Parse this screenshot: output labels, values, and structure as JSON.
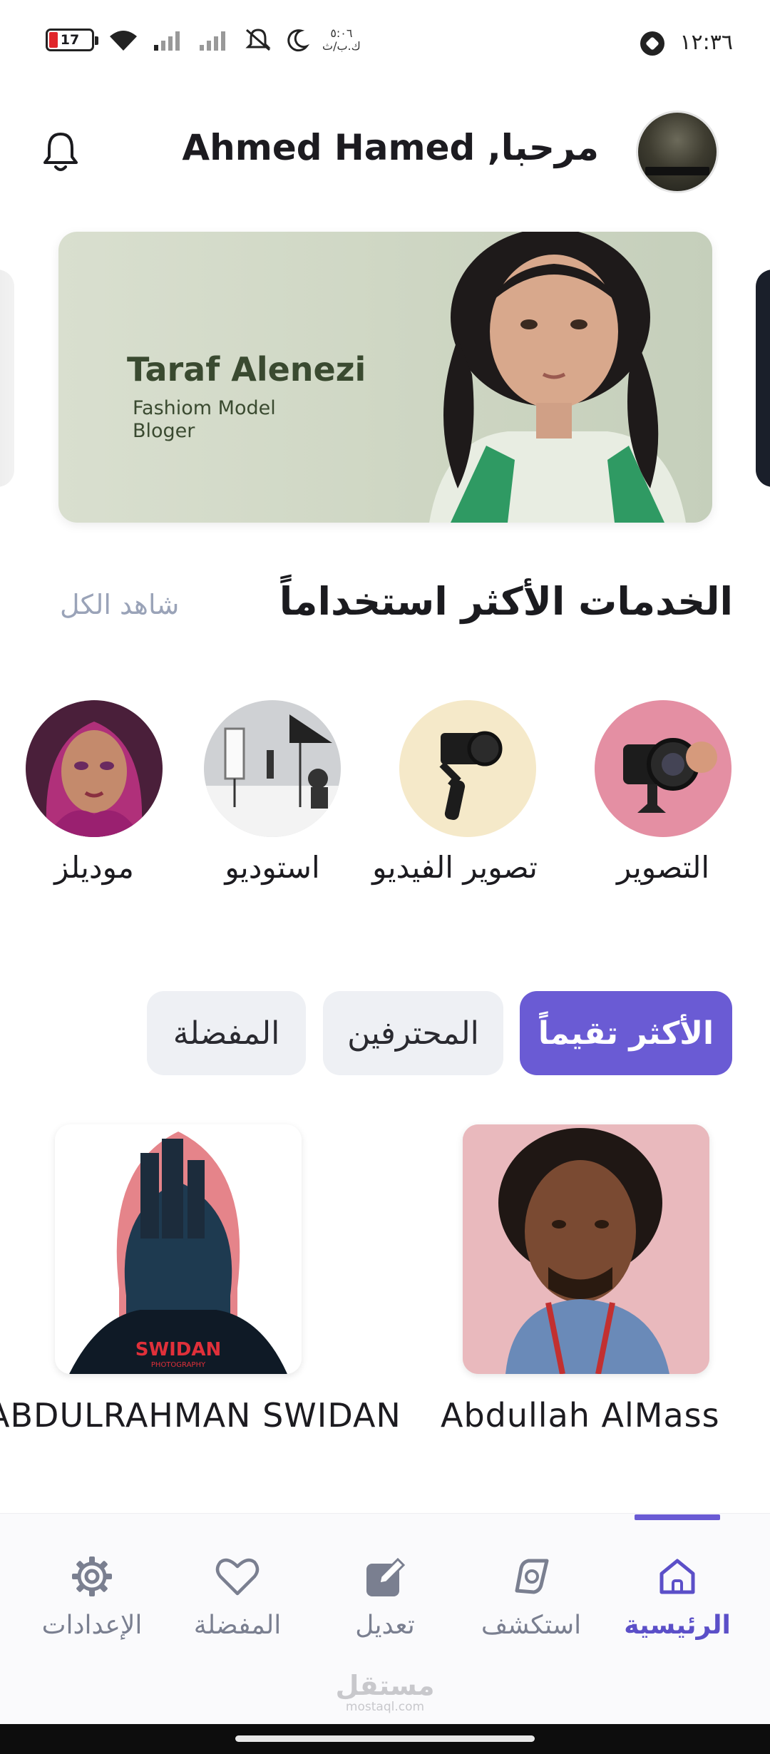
{
  "status_bar": {
    "time": "١٢:٣٦",
    "battery_level": "17",
    "clock_small_top": "٥:٠٦",
    "clock_small_bottom": "ك.ب/ث"
  },
  "header": {
    "greeting": "مرحبا, Ahmed Hamed"
  },
  "banner": {
    "name": "Taraf Alenezi",
    "subtitle_line1": "Fashiom Model",
    "subtitle_line2": "Bloger"
  },
  "services": {
    "title": "الخدمات الأكثر استخداماً",
    "see_all": "شاهد الكل",
    "items": [
      {
        "label": "التصوير"
      },
      {
        "label": "تصوير الفيديو"
      },
      {
        "label": "استوديو"
      },
      {
        "label": "موديلز"
      }
    ]
  },
  "filters": {
    "chips": [
      {
        "label": "الأكثر تقيماً",
        "active": true
      },
      {
        "label": "المحترفين",
        "active": false
      },
      {
        "label": "المفضلة",
        "active": false
      }
    ]
  },
  "professionals": [
    {
      "name": "Abdullah AlMass"
    },
    {
      "name": "ABDULRAHMAN SWIDAN",
      "card_text": "SWIDAN",
      "card_subtext": "PHOTOGRAPHY"
    }
  ],
  "bottom_nav": {
    "items": [
      {
        "label": "الرئيسية",
        "active": true
      },
      {
        "label": "استكشف",
        "active": false
      },
      {
        "label": "تعديل",
        "active": false
      },
      {
        "label": "المفضلة",
        "active": false
      },
      {
        "label": "الإعدادات",
        "active": false
      }
    ]
  },
  "watermark": {
    "text": "مستقل",
    "subtext": "mostaql.com"
  },
  "colors": {
    "accent": "#6a5bd4",
    "chip_idle": "#eef0f4",
    "muted_text": "#9aa3b8"
  }
}
